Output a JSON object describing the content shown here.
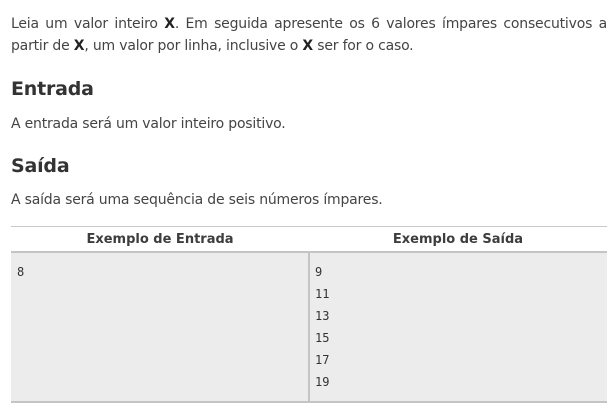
{
  "intro": {
    "line1": {
      "t1": "Leia um valor inteiro ",
      "b1": "X",
      "t2": ". Em seguida apresente os 6 valores ímpares consecutivos a"
    },
    "line2": {
      "t1": "partir de ",
      "b1": "X",
      "t2": ", um valor por linha, inclusive o ",
      "b2": "X",
      "t3": " ser for o caso."
    }
  },
  "entrada": {
    "heading": "Entrada",
    "text": "A entrada será um valor inteiro positivo."
  },
  "saida": {
    "heading": "Saída",
    "text": "A saída será uma sequência de seis números ímpares."
  },
  "example_table": {
    "headers": [
      "Exemplo de Entrada",
      "Exemplo de Saída"
    ],
    "input_lines": [
      "8"
    ],
    "output_lines": [
      "9",
      "11",
      "13",
      "15",
      "17",
      "19"
    ]
  }
}
